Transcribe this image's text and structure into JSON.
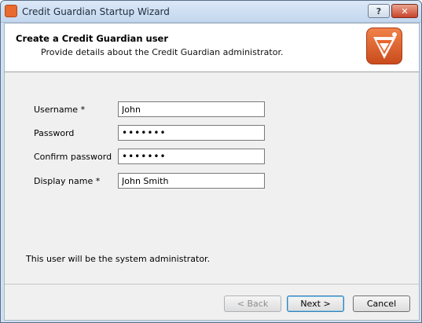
{
  "window": {
    "title": "Credit Guardian Startup Wizard",
    "help_label": "?",
    "close_label": "✕"
  },
  "header": {
    "title": "Create a Credit Guardian user",
    "subtitle": "Provide details about the Credit Guardian administrator."
  },
  "form": {
    "username_label": "Username *",
    "username_value": "John",
    "password_label": "Password",
    "password_value": "•••••••",
    "confirm_label": "Confirm password",
    "confirm_value": "•••••••",
    "display_label": "Display name *",
    "display_value": "John Smith"
  },
  "note": "This user will be the system administrator.",
  "buttons": {
    "back": "< Back",
    "next": "Next >",
    "cancel": "Cancel"
  },
  "colors": {
    "logo_orange": "#e8662c",
    "logo_dark": "#b43d18"
  }
}
